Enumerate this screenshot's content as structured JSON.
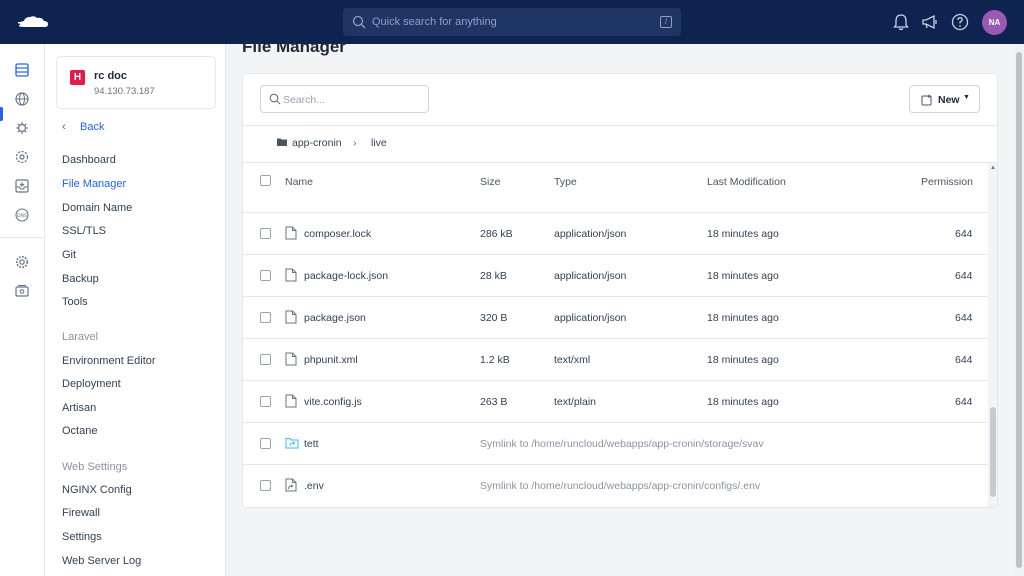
{
  "topbar": {
    "search_placeholder": "Quick search for anything",
    "shortcut": "/",
    "avatar_initials": "NA"
  },
  "server": {
    "badge": "H",
    "name": "rc doc",
    "ip": "94.130.73.187"
  },
  "sidebar": {
    "back_label": "Back",
    "items": [
      {
        "label": "Dashboard"
      },
      {
        "label": "File Manager",
        "active": true
      },
      {
        "label": "Domain Name"
      },
      {
        "label": "SSL/TLS"
      },
      {
        "label": "Git"
      },
      {
        "label": "Backup"
      },
      {
        "label": "Tools"
      }
    ],
    "laravel_title": "Laravel",
    "laravel_items": [
      {
        "label": "Environment Editor"
      },
      {
        "label": "Deployment"
      },
      {
        "label": "Artisan"
      },
      {
        "label": "Octane"
      }
    ],
    "web_title": "Web Settings",
    "web_items": [
      {
        "label": "NGINX Config"
      },
      {
        "label": "Firewall"
      },
      {
        "label": "Settings"
      },
      {
        "label": "Web Server Log"
      }
    ]
  },
  "main": {
    "title": "File Manager",
    "search_placeholder": "Search...",
    "new_label": "New",
    "breadcrumb": [
      "app-cronin",
      "live"
    ],
    "columns": {
      "name": "Name",
      "size": "Size",
      "type": "Type",
      "modified": "Last Modification",
      "permission": "Permission"
    },
    "files": [
      {
        "name": "composer.lock",
        "size": "286 kB",
        "type": "application/json",
        "modified": "18 minutes ago",
        "permission": "644"
      },
      {
        "name": "package-lock.json",
        "size": "28 kB",
        "type": "application/json",
        "modified": "18 minutes ago",
        "permission": "644"
      },
      {
        "name": "package.json",
        "size": "320 B",
        "type": "application/json",
        "modified": "18 minutes ago",
        "permission": "644"
      },
      {
        "name": "phpunit.xml",
        "size": "1.2 kB",
        "type": "text/xml",
        "modified": "18 minutes ago",
        "permission": "644"
      },
      {
        "name": "vite.config.js",
        "size": "263 B",
        "type": "text/plain",
        "modified": "18 minutes ago",
        "permission": "644"
      }
    ],
    "symlinks": [
      {
        "name": "tett",
        "target": "Symlink to /home/runcloud/webapps/app-cronin/storage/svav",
        "icon": "folder-symlink-icon"
      },
      {
        "name": ".env",
        "target": "Symlink to /home/runcloud/webapps/app-cronin/configs/.env",
        "icon": "file-symlink-icon"
      }
    ]
  },
  "colors": {
    "topbar": "#0f2350",
    "accent": "#2563eb",
    "avatar": "#9b59b6",
    "badge": "#e11d48"
  }
}
